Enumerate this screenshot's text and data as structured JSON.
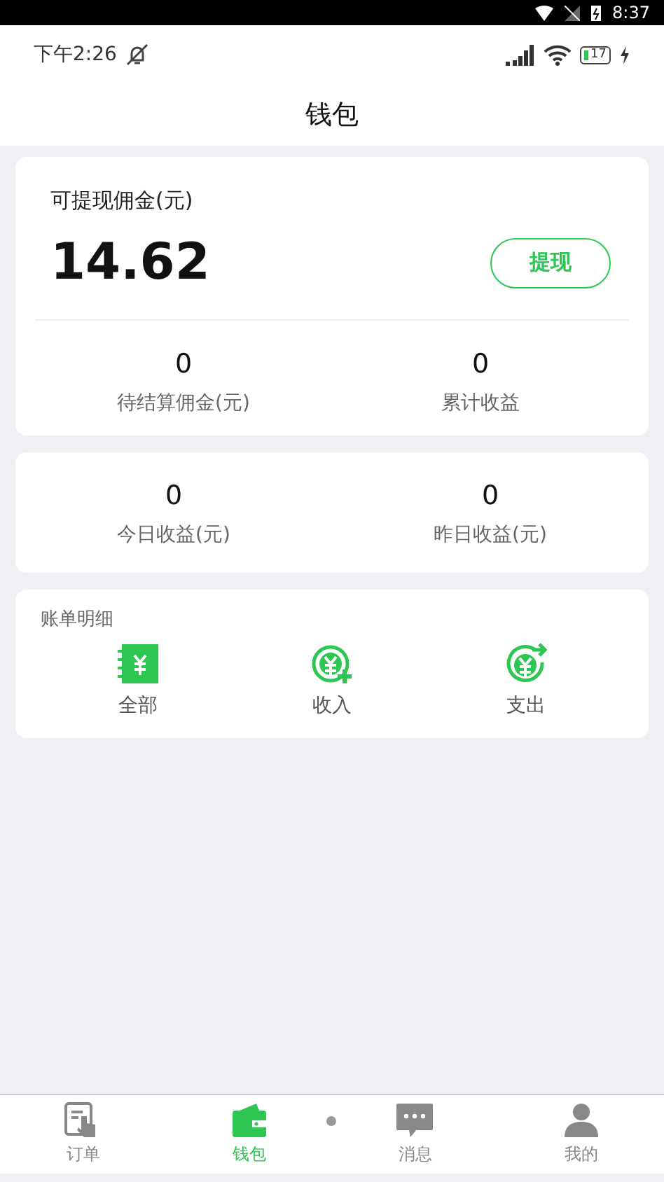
{
  "system_bar": {
    "time": "8:37"
  },
  "status_bar": {
    "time": "下午2:26",
    "battery": "17"
  },
  "title": "钱包",
  "balance_card": {
    "label": "可提现佣金(元)",
    "amount": "14.62",
    "button": "提现",
    "stats": [
      {
        "value": "0",
        "label": "待结算佣金(元)"
      },
      {
        "value": "0",
        "label": "累计收益"
      }
    ]
  },
  "earnings_card": {
    "stats": [
      {
        "value": "0",
        "label": "今日收益(元)"
      },
      {
        "value": "0",
        "label": "昨日收益(元)"
      }
    ]
  },
  "bills_card": {
    "title": "账单明细",
    "items": [
      {
        "kind": "all",
        "label": "全部"
      },
      {
        "kind": "income",
        "label": "收入"
      },
      {
        "kind": "expense",
        "label": "支出"
      }
    ]
  },
  "tabs": [
    {
      "kind": "orders",
      "label": "订单",
      "selected": false
    },
    {
      "kind": "wallet",
      "label": "钱包",
      "selected": true
    },
    {
      "kind": "messages",
      "label": "消息",
      "selected": false
    },
    {
      "kind": "profile",
      "label": "我的",
      "selected": false
    }
  ]
}
